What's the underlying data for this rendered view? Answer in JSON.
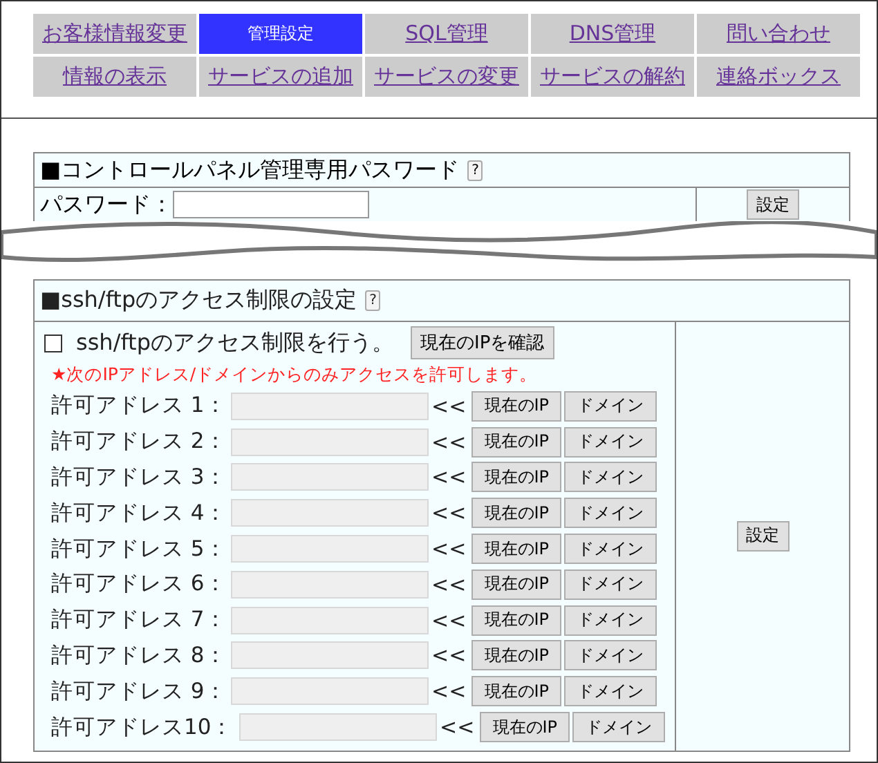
{
  "nav": [
    {
      "label": "お客様情報変更",
      "selected": false
    },
    {
      "label": "管理設定",
      "selected": true
    },
    {
      "label": "SQL管理",
      "selected": false
    },
    {
      "label": "DNS管理",
      "selected": false
    },
    {
      "label": "問い合わせ",
      "selected": false
    },
    {
      "label": "情報の表示",
      "selected": false
    },
    {
      "label": "サービスの追加",
      "selected": false
    },
    {
      "label": "サービスの変更",
      "selected": false
    },
    {
      "label": "サービスの解約",
      "selected": false
    },
    {
      "label": "連絡ボックス",
      "selected": false
    }
  ],
  "password_panel": {
    "title": "■コントロールパネル管理専用パスワード",
    "help": "?",
    "label": "パスワード：",
    "button": "設定"
  },
  "access_panel": {
    "title": "■ssh/ftpのアクセス制限の設定",
    "help": "?",
    "restrict": {
      "label": "ssh/ftpのアクセス制限を行う。",
      "checked": false
    },
    "check_ip_button": "現在のIPを確認",
    "notice": "★次のIPアドレス/ドメインからのみアクセスを許可します。",
    "rows": [
      {
        "label": "許可アドレス 1：",
        "arrow": "<<",
        "ip_button": "現在のIP",
        "domain_button": "ドメイン"
      },
      {
        "label": "許可アドレス 2：",
        "arrow": "<<",
        "ip_button": "現在のIP",
        "domain_button": "ドメイン"
      },
      {
        "label": "許可アドレス 3：",
        "arrow": "<<",
        "ip_button": "現在のIP",
        "domain_button": "ドメイン"
      },
      {
        "label": "許可アドレス 4：",
        "arrow": "<<",
        "ip_button": "現在のIP",
        "domain_button": "ドメイン"
      },
      {
        "label": "許可アドレス 5：",
        "arrow": "<<",
        "ip_button": "現在のIP",
        "domain_button": "ドメイン"
      },
      {
        "label": "許可アドレス 6：",
        "arrow": "<<",
        "ip_button": "現在のIP",
        "domain_button": "ドメイン"
      },
      {
        "label": "許可アドレス 7：",
        "arrow": "<<",
        "ip_button": "現在のIP",
        "domain_button": "ドメイン"
      },
      {
        "label": "許可アドレス 8：",
        "arrow": "<<",
        "ip_button": "現在のIP",
        "domain_button": "ドメイン"
      },
      {
        "label": "許可アドレス 9：",
        "arrow": "<<",
        "ip_button": "現在のIP",
        "domain_button": "ドメイン"
      },
      {
        "label": "許可アドレス10：",
        "arrow": "<<",
        "ip_button": "現在のIP",
        "domain_button": "ドメイン"
      }
    ],
    "submit_button": "設定"
  }
}
